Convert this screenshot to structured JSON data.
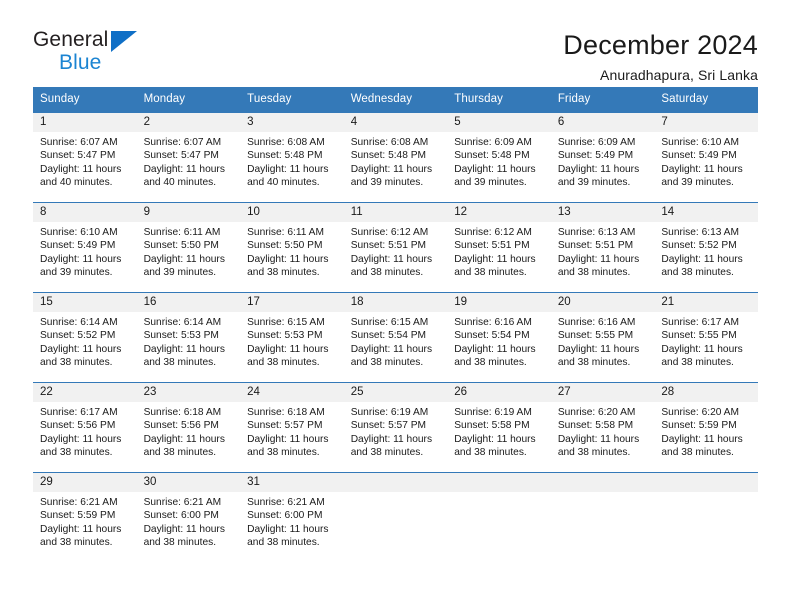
{
  "brand": {
    "name_part1": "General",
    "name_part2": "Blue",
    "triangle_icon": "blue-triangle-icon",
    "color_dark": "#231f20",
    "color_blue": "#1b84d2"
  },
  "header": {
    "title": "December 2024",
    "subtitle": "Anuradhapura, Sri Lanka"
  },
  "theme": {
    "header_blue": "#3479b8",
    "daynum_band": "#f1f1f1",
    "text": "#1a1a1a"
  },
  "calendar": {
    "weekday_headers": [
      "Sunday",
      "Monday",
      "Tuesday",
      "Wednesday",
      "Thursday",
      "Friday",
      "Saturday"
    ],
    "labels": {
      "sunrise_prefix": "Sunrise: ",
      "sunset_prefix": "Sunset: ",
      "daylight_prefix": "Daylight: "
    },
    "weeks": [
      [
        {
          "day": "1",
          "sunrise": "Sunrise: 6:07 AM",
          "sunset": "Sunset: 5:47 PM",
          "daylight1": "Daylight: 11 hours",
          "daylight2": "and 40 minutes."
        },
        {
          "day": "2",
          "sunrise": "Sunrise: 6:07 AM",
          "sunset": "Sunset: 5:47 PM",
          "daylight1": "Daylight: 11 hours",
          "daylight2": "and 40 minutes."
        },
        {
          "day": "3",
          "sunrise": "Sunrise: 6:08 AM",
          "sunset": "Sunset: 5:48 PM",
          "daylight1": "Daylight: 11 hours",
          "daylight2": "and 40 minutes."
        },
        {
          "day": "4",
          "sunrise": "Sunrise: 6:08 AM",
          "sunset": "Sunset: 5:48 PM",
          "daylight1": "Daylight: 11 hours",
          "daylight2": "and 39 minutes."
        },
        {
          "day": "5",
          "sunrise": "Sunrise: 6:09 AM",
          "sunset": "Sunset: 5:48 PM",
          "daylight1": "Daylight: 11 hours",
          "daylight2": "and 39 minutes."
        },
        {
          "day": "6",
          "sunrise": "Sunrise: 6:09 AM",
          "sunset": "Sunset: 5:49 PM",
          "daylight1": "Daylight: 11 hours",
          "daylight2": "and 39 minutes."
        },
        {
          "day": "7",
          "sunrise": "Sunrise: 6:10 AM",
          "sunset": "Sunset: 5:49 PM",
          "daylight1": "Daylight: 11 hours",
          "daylight2": "and 39 minutes."
        }
      ],
      [
        {
          "day": "8",
          "sunrise": "Sunrise: 6:10 AM",
          "sunset": "Sunset: 5:49 PM",
          "daylight1": "Daylight: 11 hours",
          "daylight2": "and 39 minutes."
        },
        {
          "day": "9",
          "sunrise": "Sunrise: 6:11 AM",
          "sunset": "Sunset: 5:50 PM",
          "daylight1": "Daylight: 11 hours",
          "daylight2": "and 39 minutes."
        },
        {
          "day": "10",
          "sunrise": "Sunrise: 6:11 AM",
          "sunset": "Sunset: 5:50 PM",
          "daylight1": "Daylight: 11 hours",
          "daylight2": "and 38 minutes."
        },
        {
          "day": "11",
          "sunrise": "Sunrise: 6:12 AM",
          "sunset": "Sunset: 5:51 PM",
          "daylight1": "Daylight: 11 hours",
          "daylight2": "and 38 minutes."
        },
        {
          "day": "12",
          "sunrise": "Sunrise: 6:12 AM",
          "sunset": "Sunset: 5:51 PM",
          "daylight1": "Daylight: 11 hours",
          "daylight2": "and 38 minutes."
        },
        {
          "day": "13",
          "sunrise": "Sunrise: 6:13 AM",
          "sunset": "Sunset: 5:51 PM",
          "daylight1": "Daylight: 11 hours",
          "daylight2": "and 38 minutes."
        },
        {
          "day": "14",
          "sunrise": "Sunrise: 6:13 AM",
          "sunset": "Sunset: 5:52 PM",
          "daylight1": "Daylight: 11 hours",
          "daylight2": "and 38 minutes."
        }
      ],
      [
        {
          "day": "15",
          "sunrise": "Sunrise: 6:14 AM",
          "sunset": "Sunset: 5:52 PM",
          "daylight1": "Daylight: 11 hours",
          "daylight2": "and 38 minutes."
        },
        {
          "day": "16",
          "sunrise": "Sunrise: 6:14 AM",
          "sunset": "Sunset: 5:53 PM",
          "daylight1": "Daylight: 11 hours",
          "daylight2": "and 38 minutes."
        },
        {
          "day": "17",
          "sunrise": "Sunrise: 6:15 AM",
          "sunset": "Sunset: 5:53 PM",
          "daylight1": "Daylight: 11 hours",
          "daylight2": "and 38 minutes."
        },
        {
          "day": "18",
          "sunrise": "Sunrise: 6:15 AM",
          "sunset": "Sunset: 5:54 PM",
          "daylight1": "Daylight: 11 hours",
          "daylight2": "and 38 minutes."
        },
        {
          "day": "19",
          "sunrise": "Sunrise: 6:16 AM",
          "sunset": "Sunset: 5:54 PM",
          "daylight1": "Daylight: 11 hours",
          "daylight2": "and 38 minutes."
        },
        {
          "day": "20",
          "sunrise": "Sunrise: 6:16 AM",
          "sunset": "Sunset: 5:55 PM",
          "daylight1": "Daylight: 11 hours",
          "daylight2": "and 38 minutes."
        },
        {
          "day": "21",
          "sunrise": "Sunrise: 6:17 AM",
          "sunset": "Sunset: 5:55 PM",
          "daylight1": "Daylight: 11 hours",
          "daylight2": "and 38 minutes."
        }
      ],
      [
        {
          "day": "22",
          "sunrise": "Sunrise: 6:17 AM",
          "sunset": "Sunset: 5:56 PM",
          "daylight1": "Daylight: 11 hours",
          "daylight2": "and 38 minutes."
        },
        {
          "day": "23",
          "sunrise": "Sunrise: 6:18 AM",
          "sunset": "Sunset: 5:56 PM",
          "daylight1": "Daylight: 11 hours",
          "daylight2": "and 38 minutes."
        },
        {
          "day": "24",
          "sunrise": "Sunrise: 6:18 AM",
          "sunset": "Sunset: 5:57 PM",
          "daylight1": "Daylight: 11 hours",
          "daylight2": "and 38 minutes."
        },
        {
          "day": "25",
          "sunrise": "Sunrise: 6:19 AM",
          "sunset": "Sunset: 5:57 PM",
          "daylight1": "Daylight: 11 hours",
          "daylight2": "and 38 minutes."
        },
        {
          "day": "26",
          "sunrise": "Sunrise: 6:19 AM",
          "sunset": "Sunset: 5:58 PM",
          "daylight1": "Daylight: 11 hours",
          "daylight2": "and 38 minutes."
        },
        {
          "day": "27",
          "sunrise": "Sunrise: 6:20 AM",
          "sunset": "Sunset: 5:58 PM",
          "daylight1": "Daylight: 11 hours",
          "daylight2": "and 38 minutes."
        },
        {
          "day": "28",
          "sunrise": "Sunrise: 6:20 AM",
          "sunset": "Sunset: 5:59 PM",
          "daylight1": "Daylight: 11 hours",
          "daylight2": "and 38 minutes."
        }
      ],
      [
        {
          "day": "29",
          "sunrise": "Sunrise: 6:21 AM",
          "sunset": "Sunset: 5:59 PM",
          "daylight1": "Daylight: 11 hours",
          "daylight2": "and 38 minutes."
        },
        {
          "day": "30",
          "sunrise": "Sunrise: 6:21 AM",
          "sunset": "Sunset: 6:00 PM",
          "daylight1": "Daylight: 11 hours",
          "daylight2": "and 38 minutes."
        },
        {
          "day": "31",
          "sunrise": "Sunrise: 6:21 AM",
          "sunset": "Sunset: 6:00 PM",
          "daylight1": "Daylight: 11 hours",
          "daylight2": "and 38 minutes."
        },
        {
          "day": "",
          "sunrise": "",
          "sunset": "",
          "daylight1": "",
          "daylight2": ""
        },
        {
          "day": "",
          "sunrise": "",
          "sunset": "",
          "daylight1": "",
          "daylight2": ""
        },
        {
          "day": "",
          "sunrise": "",
          "sunset": "",
          "daylight1": "",
          "daylight2": ""
        },
        {
          "day": "",
          "sunrise": "",
          "sunset": "",
          "daylight1": "",
          "daylight2": ""
        }
      ]
    ]
  }
}
